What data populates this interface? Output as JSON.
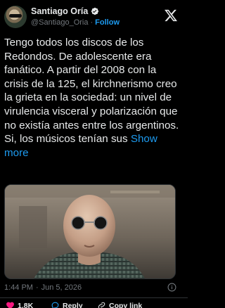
{
  "author": {
    "name": "Santiago Oría",
    "handle": "@Santiago_Oria",
    "separator": "·",
    "follow_label": "Follow",
    "verified": true
  },
  "tweet": {
    "text": "Tengo todos los discos de los Redondos. De adolescente era fanático. A partir del 2008 con la crisis de la 125, el kirchnerismo creo la grieta en la sociedad: un nivel de virulencia visceral y polarización que no existía antes entre los argentinos. Si, los músicos tenían sus",
    "show_more_label": "Show more"
  },
  "meta": {
    "time": "1:44 PM",
    "separator": "·",
    "date": "Jun 5, 2026"
  },
  "actions": {
    "like_count": "1.8K",
    "reply_label": "Reply",
    "copy_link_label": "Copy link"
  },
  "colors": {
    "background": "#000000",
    "text": "#e7e9ea",
    "muted": "#71767b",
    "accent": "#1d9bf0",
    "like": "#f91880"
  },
  "icons": {
    "verified": "verified-badge-icon",
    "logo": "x-logo-icon",
    "info": "info-icon",
    "like": "heart-icon",
    "reply": "reply-icon",
    "copy_link": "link-icon"
  }
}
